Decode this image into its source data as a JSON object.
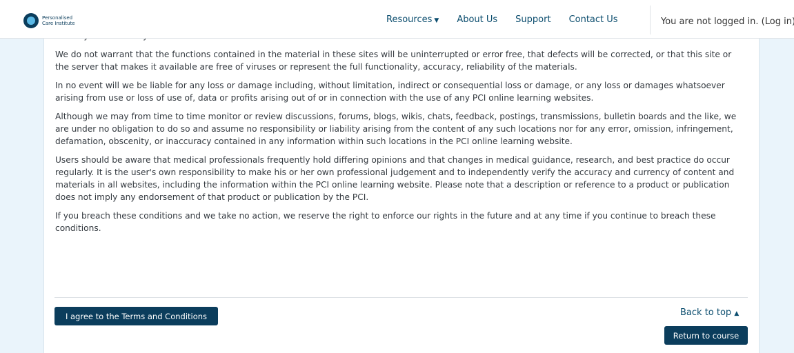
{
  "header": {
    "logo_line1": "Personalised",
    "logo_line2": "Care Institute",
    "nav": [
      "Resources",
      "About Us",
      "Support",
      "Contact Us"
    ],
    "login_text": "You are not logged in. (Log in)"
  },
  "content": {
    "paragraphs": [
      "security and accuracy.",
      "We do not warrant that the functions contained in the material in these sites will be uninterrupted or error free, that defects will be corrected, or that this site or the server that makes it available are free of viruses or represent the full functionality, accuracy, reliability of the materials.",
      "In no event will we be liable for any loss or damage including, without limitation, indirect or consequential loss or damage, or any loss or damages whatsoever arising from use or loss of use of, data or profits arising out of or in connection with the use of any PCI online learning websites.",
      "Although we may from time to time monitor or review discussions, forums, blogs, wikis, chats, feedback, postings, transmissions, bulletin boards and the like, we are under no obligation to do so and assume no responsibility or liability arising from the content of any such locations nor for any error, omission, infringement, defamation, obscenity, or inaccuracy contained in any information within such locations in the PCI online learning website.",
      "Users should be aware that medical professionals frequently hold differing opinions and that changes in medical guidance, research, and best practice do occur regularly. It is the user's own responsibility to make his or her own professional judgement and to independently verify the accuracy and currency of content and materials in all websites, including the information within the PCI online learning website. Please note that a description or reference to a product or publication does not imply any endorsement of that product or publication by the PCI.",
      "If you breach these conditions and we take no action, we reserve the right to enforce our rights in the future and at any time if you continue to breach these conditions."
    ]
  },
  "footer": {
    "agree_label": "I agree to the Terms and Conditions",
    "back_to_top": "Back to top",
    "return_label": "Return to course"
  },
  "colors": {
    "brand": "#0b3d5c",
    "link": "#0b4d6e",
    "background": "#eaf4fb"
  }
}
